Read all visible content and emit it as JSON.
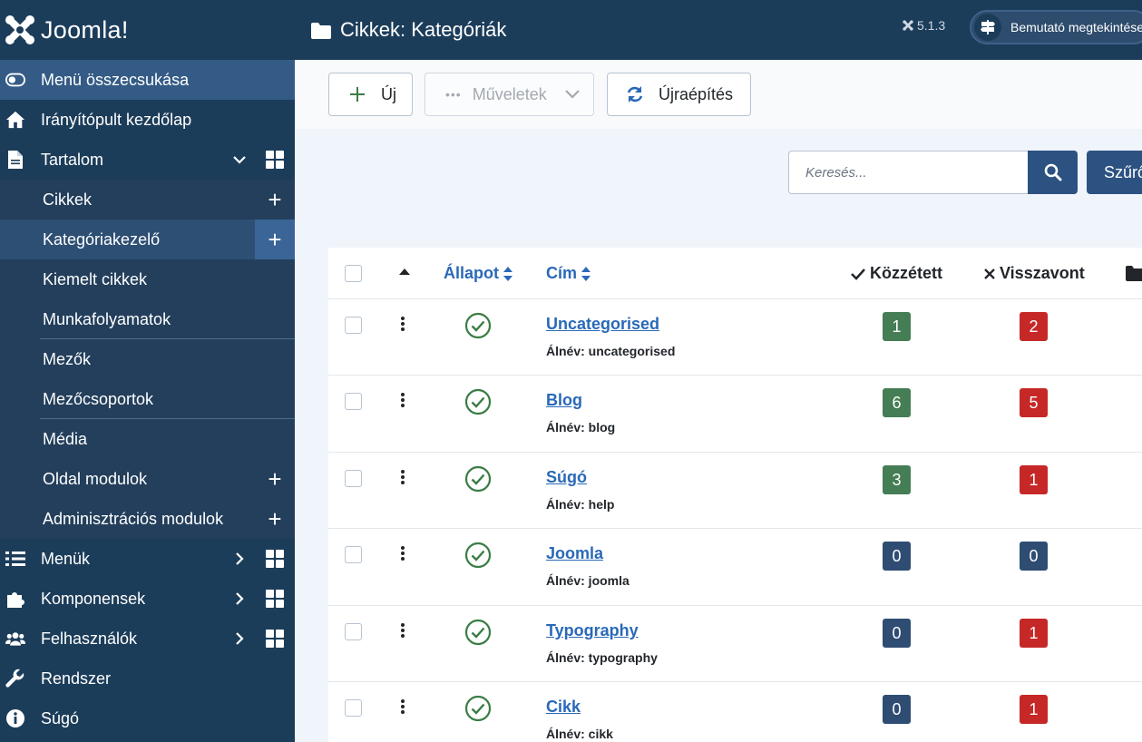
{
  "brand": {
    "name": "Joomla!",
    "logo_text": "Joomla!"
  },
  "header": {
    "title": "Cikkek: Kategóriák",
    "version": "5.1.3",
    "preview_label": "Bemutató megtekintése"
  },
  "sidebar": {
    "collapse_label": "Menü összecsukása",
    "items": [
      {
        "label": "Irányítópult kezdőlap",
        "icon": "home-icon"
      },
      {
        "label": "Tartalom",
        "icon": "file-icon"
      },
      {
        "label": "Cikkek"
      },
      {
        "label": "Kategóriakezelő"
      },
      {
        "label": "Kiemelt cikkek"
      },
      {
        "label": "Munkafolyamatok"
      },
      {
        "label": "Mezők"
      },
      {
        "label": "Mezőcsoportok"
      },
      {
        "label": "Média"
      },
      {
        "label": "Oldal modulok"
      },
      {
        "label": "Adminisztrációs modulok"
      },
      {
        "label": "Menük",
        "icon": "list-icon"
      },
      {
        "label": "Komponensek",
        "icon": "puzzle-icon"
      },
      {
        "label": "Felhasználók",
        "icon": "users-icon"
      },
      {
        "label": "Rendszer",
        "icon": "wrench-icon"
      },
      {
        "label": "Súgó",
        "icon": "info-icon"
      }
    ]
  },
  "toolbar": {
    "new_label": "Új",
    "actions_label": "Műveletek",
    "rebuild_label": "Újraépítés"
  },
  "search": {
    "placeholder": "Keresés...",
    "filter_label": "Szűrő"
  },
  "table": {
    "columns": {
      "status": "Állapot",
      "title": "Cím",
      "published": "Közzétett",
      "unpublished": "Visszavont"
    },
    "rows": [
      {
        "title": "Uncategorised",
        "alias": "Álnév: uncategorised",
        "published": "1",
        "unpublished": "2"
      },
      {
        "title": "Blog",
        "alias": "Álnév: blog",
        "published": "6",
        "unpublished": "5"
      },
      {
        "title": "Súgó",
        "alias": "Álnév: help",
        "published": "3",
        "unpublished": "1"
      },
      {
        "title": "Joomla",
        "alias": "Álnév: joomla",
        "published": "0",
        "unpublished": "0"
      },
      {
        "title": "Typography",
        "alias": "Álnév: typography",
        "published": "0",
        "unpublished": "1"
      },
      {
        "title": "Cikk",
        "alias": "Álnév: cikk",
        "published": "0",
        "unpublished": "1"
      }
    ]
  },
  "colors": {
    "sidebar_bg": "#1c3d5a",
    "accent": "#2c5282",
    "published_badge": "#457d54",
    "unpublished_badge": "#c52827",
    "zero_badge": "#2f4d73",
    "link": "#2a69b8"
  }
}
